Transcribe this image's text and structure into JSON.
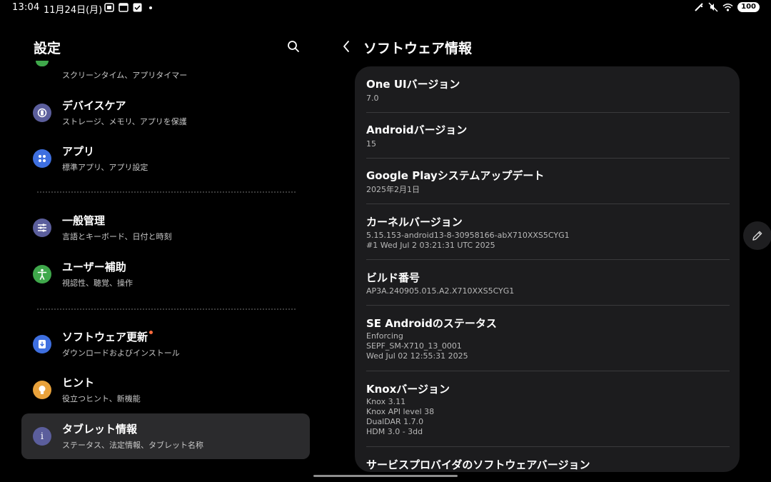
{
  "status_bar": {
    "time": "13:04",
    "date": "11月24日(月)",
    "battery": "100"
  },
  "left_pane": {
    "title": "設定",
    "partial_item_subtitle": "スクリーンタイム、アプリタイマー",
    "items": [
      {
        "title": "デバイスケア",
        "subtitle": "ストレージ、メモリ、アプリを保護",
        "icon": "device-care-icon",
        "color": "#5b5e9c"
      },
      {
        "title": "アプリ",
        "subtitle": "標準アプリ、アプリ設定",
        "icon": "apps-icon",
        "color": "#3e6fe0"
      },
      {
        "title": "一般管理",
        "subtitle": "言語とキーボード、日付と時刻",
        "icon": "sliders-icon",
        "color": "#5b5e9c"
      },
      {
        "title": "ユーザー補助",
        "subtitle": "視認性、聴覚、操作",
        "icon": "accessibility-icon",
        "color": "#3fa84b"
      },
      {
        "title": "ソフトウェア更新",
        "subtitle": "ダウンロードおよびインストール",
        "icon": "software-update-icon",
        "color": "#3e6fe0"
      },
      {
        "title": "ヒント",
        "subtitle": "役立つヒント、新機能",
        "icon": "lightbulb-icon",
        "color": "#e9a23b"
      },
      {
        "title": "タブレット情報",
        "subtitle": "ステータス、法定情報、タブレット名称",
        "icon": "info-icon",
        "color": "#5b5e9c"
      }
    ],
    "info_glyph": "i"
  },
  "right_pane": {
    "title": "ソフトウェア情報",
    "rows": [
      {
        "title": "One UIバージョン",
        "values": [
          "7.0"
        ]
      },
      {
        "title": "Androidバージョン",
        "values": [
          "15"
        ]
      },
      {
        "title": "Google Playシステムアップデート",
        "values": [
          "2025年2月1日"
        ]
      },
      {
        "title": "カーネルバージョン",
        "values": [
          "5.15.153-android13-8-30958166-abX710XXS5CYG1",
          "#1 Wed Jul 2 03:21:31 UTC 2025"
        ]
      },
      {
        "title": "ビルド番号",
        "values": [
          "AP3A.240905.015.A2.X710XXS5CYG1"
        ]
      },
      {
        "title": "SE Androidのステータス",
        "values": [
          "Enforcing",
          "SEPF_SM-X710_13_0001",
          "Wed Jul 02 12:55:31 2025"
        ]
      },
      {
        "title": "Knoxバージョン",
        "values": [
          "Knox 3.11",
          "Knox API level 38",
          "DualDAR 1.7.0",
          "HDM 3.0 - 3dd"
        ]
      },
      {
        "title": "サービスプロバイダのソフトウェアバージョン",
        "values": []
      }
    ]
  }
}
